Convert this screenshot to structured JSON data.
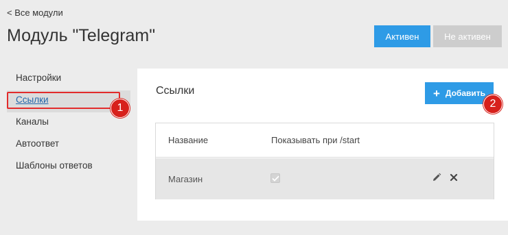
{
  "nav": {
    "back_label": "< Все модули"
  },
  "header": {
    "title": "Модуль \"Telegram\"",
    "active_label": "Активен",
    "inactive_label": "Не активен"
  },
  "sidebar": {
    "items": [
      {
        "label": "Настройки",
        "active": false
      },
      {
        "label": "Ссылки",
        "active": true
      },
      {
        "label": "Каналы",
        "active": false
      },
      {
        "label": "Автоответ",
        "active": false
      },
      {
        "label": "Шаблоны ответов",
        "active": false
      }
    ]
  },
  "markers": {
    "first": "1",
    "second": "2"
  },
  "main": {
    "title": "Ссылки",
    "add_label": "Добавить",
    "table": {
      "columns": [
        "Название",
        "Показывать при /start"
      ],
      "rows": [
        {
          "name": "Магазин",
          "show_on_start": true
        }
      ]
    }
  },
  "colors": {
    "accent": "#2e9be6",
    "disabled": "#cdcdcd",
    "marker": "#d7201b",
    "highlight": "#e22a2a"
  },
  "icons": {
    "add": "plus-icon",
    "edit": "pencil-icon",
    "delete": "close-icon",
    "checkbox": "check-icon"
  }
}
